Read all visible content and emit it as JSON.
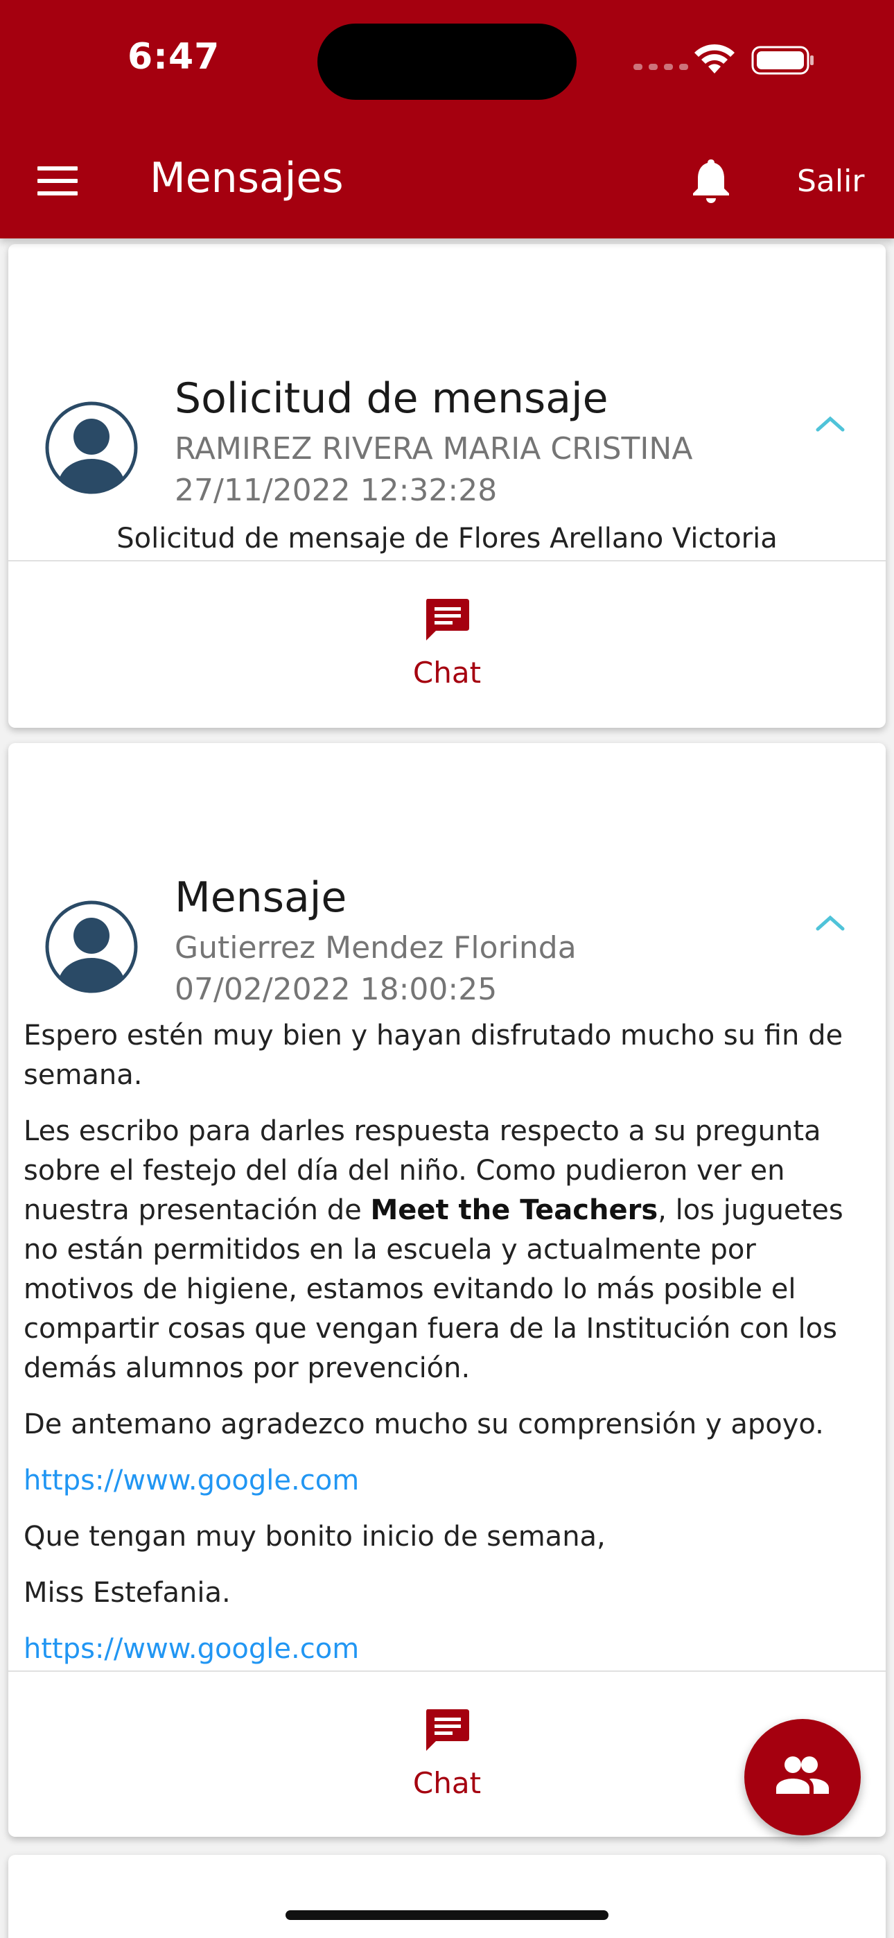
{
  "status_bar": {
    "time": "6:47"
  },
  "header": {
    "title": "Mensajes",
    "logout_label": "Salir",
    "icons": [
      "menu-icon",
      "bell-icon"
    ]
  },
  "messages": [
    {
      "title": "Solicitud de mensaje",
      "sender": "RAMIREZ RIVERA MARIA CRISTINA",
      "date": "27/11/2022 12:32:28",
      "summary": "Solicitud de mensaje de Flores Arellano Victoria",
      "chat_label": "Chat"
    },
    {
      "title": "Mensaje",
      "sender": "Gutierrez Mendez Florinda",
      "date": "07/02/2022 18:00:25",
      "body": {
        "p1": "Espero estén muy bien y hayan disfrutado mucho su fin de semana.",
        "p2_before": "Les escribo para darles respuesta respecto a su pregunta sobre el festejo del día del niño. Como pudieron ver en nuestra presentación de ",
        "p2_bold": "Meet the Teachers",
        "p2_after": ", los juguetes no están permitidos en la escuela y actualmente por motivos de higiene, estamos evitando lo más posible el compartir cosas que vengan fuera de la Institución con los demás alumnos por prevención.",
        "p3": "De antemano agradezco mucho su comprensión y apoyo.",
        "link1": "https://www.google.com",
        "p4": "Que tengan muy bonito inicio de semana,",
        "p5": "Miss Estefania.",
        "link2": "https://www.google.com"
      },
      "chat_label": "Chat"
    }
  ],
  "colors": {
    "primary": "#a5000f",
    "link": "#2196f3",
    "chevron": "#4fc3d9",
    "avatar": "#2a4a66"
  }
}
